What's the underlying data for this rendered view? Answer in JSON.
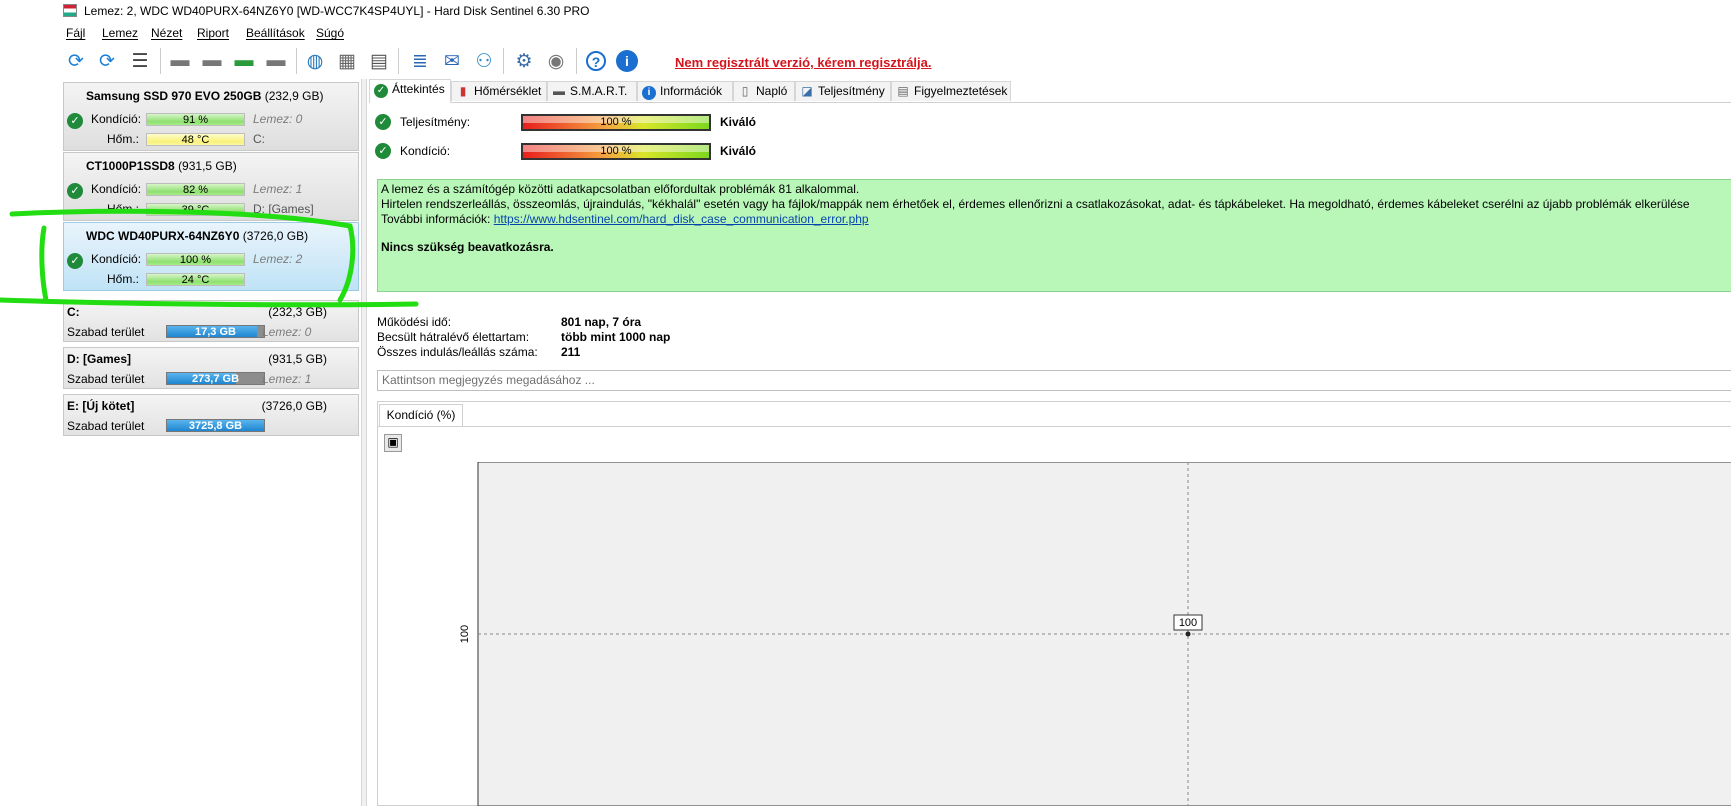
{
  "window": {
    "title": "Lemez: 2, WDC WD40PURX-64NZ6Y0 [WD-WCC7K4SP4UYL]  -  Hard Disk Sentinel 6.30 PRO"
  },
  "menu": [
    "Fájl",
    "Lemez",
    "Nézet",
    "Riport",
    "Beállítások",
    "Súgó"
  ],
  "toolbar": {
    "not_registered": "Nem regisztrált verzió, kérem regisztrálja.",
    "icons": [
      "refresh-icon",
      "refresh-warning-icon",
      "disk-list-icon",
      "disk-icon",
      "disk-clock-icon",
      "disk-check-icon",
      "disk-search-icon",
      "globe-disk-icon",
      "server-icon",
      "printer-icon",
      "report-icon",
      "mail-icon",
      "network-icon",
      "settings-icon",
      "sound-icon",
      "help-icon",
      "info-icon"
    ]
  },
  "disks": [
    {
      "name": "Samsung SSD 970 EVO 250GB",
      "size": "(232,9 GB)",
      "condition_label": "Kondíció:",
      "condition": "91 %",
      "temp_label": "Hőm.:",
      "temp": "48 °C",
      "disk_no": "Lemez: 0",
      "volumes": "C:",
      "temp_color": "yellow"
    },
    {
      "name": "CT1000P1SSD8",
      "size": "(931,5 GB)",
      "condition_label": "Kondíció:",
      "condition": "82 %",
      "temp_label": "Hőm.:",
      "temp": "39 °C",
      "disk_no": "Lemez: 1",
      "volumes": "D: [Games]",
      "temp_color": "green"
    },
    {
      "name": "WDC WD40PURX-64NZ6Y0",
      "size": "(3726,0 GB)",
      "condition_label": "Kondíció:",
      "condition": "100 %",
      "temp_label": "Hőm.:",
      "temp": "24 °C",
      "disk_no": "Lemez: 2",
      "volumes": "",
      "temp_color": "green"
    }
  ],
  "volumes": [
    {
      "name": "C:",
      "size": "(232,3 GB)",
      "free_label": "Szabad terület",
      "free": "17,3 GB",
      "free_fraction": 0.07,
      "disk_no": "Lemez: 0"
    },
    {
      "name": "D: [Games]",
      "size": "(931,5 GB)",
      "free_label": "Szabad terület",
      "free": "273,7 GB",
      "free_fraction": 0.29,
      "disk_no": "Lemez: 1"
    },
    {
      "name": "E: [Új kötet]",
      "size": "(3726,0 GB)",
      "free_label": "Szabad terület",
      "free": "3725,8 GB",
      "free_fraction": 0.0,
      "disk_no": ""
    }
  ],
  "tabs": [
    "Áttekintés",
    "Hőmérséklet",
    "S.M.A.R.T.",
    "Információk",
    "Napló",
    "Teljesítmény",
    "Figyelmeztetések"
  ],
  "overview": {
    "perf_label": "Teljesítmény:",
    "perf_value": "100 %",
    "perf_rating": "Kiváló",
    "cond_label": "Kondíció:",
    "cond_value": "100 %",
    "cond_rating": "Kiváló",
    "message_line1": "A lemez és a számítógép közötti adatkapcsolatban előfordultak problémák 81 alkalommal.",
    "message_line2": "Hirtelen rendszerleállás, összeomlás, újraindulás, \"kékhalál\" esetén vagy ha fájlok/mappák nem érhetőek el, érdemes ellenőrizni a csatlakozásokat, adat- és tápkábeleket. Ha megoldható, érdemes kábeleket cserélni az újabb problémák elkerülése",
    "message_more_label": "További információk: ",
    "message_link": "https://www.hdsentinel.com/hard_disk_case_communication_error.php",
    "message_action": "Nincs szükség beavatkozásra.",
    "uptime_label": "Működési idő:",
    "uptime": "801 nap, 7 óra",
    "lifetime_label": "Becsült hátralévő élettartam:",
    "lifetime": "több mint 1000 nap",
    "startstop_label": "Összes indulás/leállás száma:",
    "startstop": "211",
    "note_placeholder": "Kattintson megjegyzés megadásához ...",
    "chart_tab": "Kondíció  (%)"
  },
  "chart_data": {
    "type": "line",
    "title": "Kondíció  (%)",
    "xlabel": "",
    "ylabel": "",
    "y_ticks": [
      "100"
    ],
    "series": [
      {
        "values": [
          100
        ]
      }
    ],
    "point_label": "100",
    "ylim": [
      0,
      200
    ]
  },
  "colors": {
    "accent": "#0078d7",
    "good": "#1f8a3a",
    "warning_text": "#d4141c",
    "message_bg": "#b9f7b9",
    "annotation": "#22dd11"
  }
}
